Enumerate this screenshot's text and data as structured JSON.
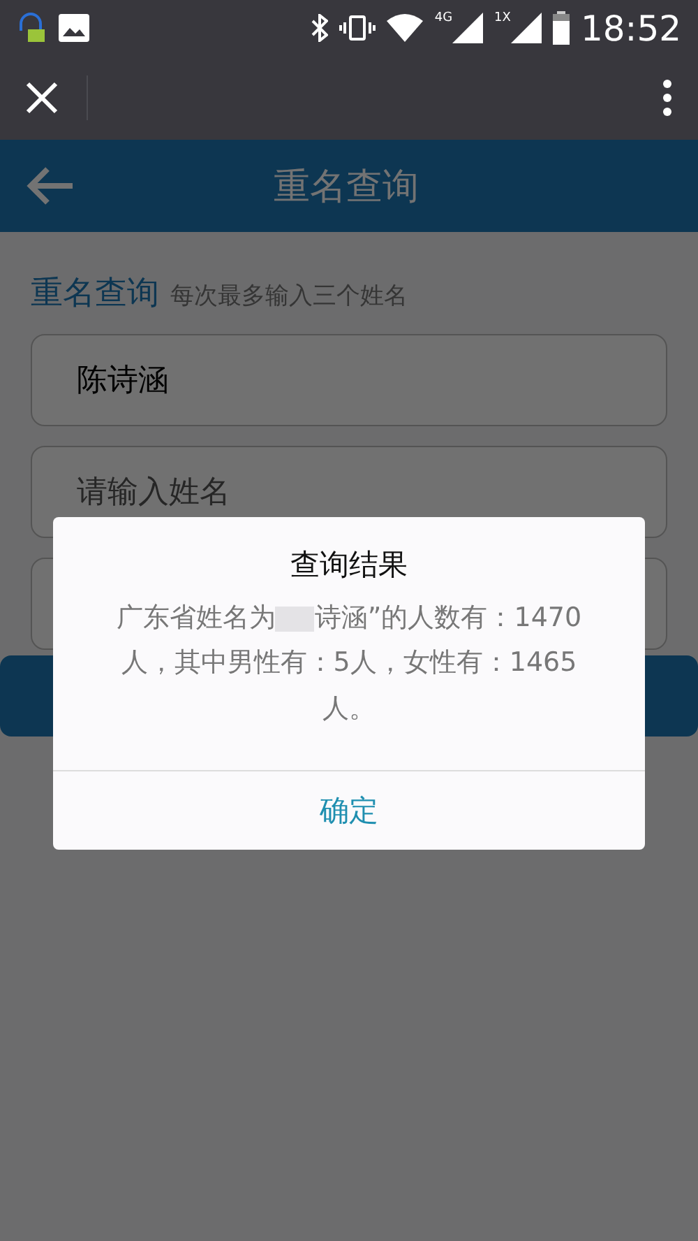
{
  "status_bar": {
    "network_labels": [
      "4G",
      "1X"
    ],
    "time": "18:52"
  },
  "header": {
    "title": "重名查询"
  },
  "section": {
    "title": "重名查询",
    "hint": "每次最多输入三个姓名"
  },
  "inputs": [
    {
      "kind": "input",
      "value": "陈诗涵"
    },
    {
      "kind": "input",
      "placeholder": "请输入姓名"
    },
    {
      "kind": "input"
    }
  ],
  "dialog": {
    "title": "查询结果",
    "message_before": "广东省姓名为",
    "message_after": "诗涵”的人数有：1470人，其中男性有：5人，女性有：1465人。",
    "buttons": [
      "确定"
    ]
  }
}
